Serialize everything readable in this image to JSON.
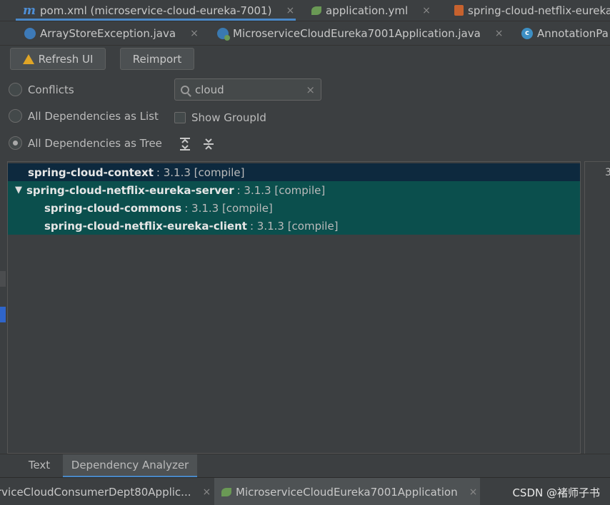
{
  "editor_tabs_row1": [
    {
      "label": "pom.xml (microservice-cloud-eureka-7001)",
      "icon": "maven-m-icon",
      "active": true
    },
    {
      "label": "application.yml",
      "icon": "spring-leaf-icon"
    },
    {
      "label": "spring-cloud-netflix-eureka",
      "icon": "xml-file-icon"
    }
  ],
  "editor_tabs_row2": [
    {
      "label": "ArrayStoreException.java",
      "icon": "exception-class-icon"
    },
    {
      "label": "MicroserviceCloudEureka7001Application.java",
      "icon": "spring-app-class-icon"
    },
    {
      "label": "AnnotationPa",
      "icon": "class-icon"
    }
  ],
  "toolbar": {
    "refresh_label": "Refresh UI",
    "reimport_label": "Reimport"
  },
  "view_options": {
    "conflicts": "Conflicts",
    "as_list": "All Dependencies as List",
    "as_tree": "All Dependencies as Tree",
    "selected": "as_tree",
    "show_group_id": "Show GroupId",
    "show_group_id_checked": false
  },
  "search": {
    "value": "cloud"
  },
  "tree": [
    {
      "name": "spring-cloud-context",
      "version": ": 3.1.3 [compile]",
      "level": 0,
      "state": "selected"
    },
    {
      "name": "spring-cloud-netflix-eureka-server",
      "version": ": 3.1.3 [compile]",
      "level": 0,
      "state": "match",
      "expanded": true
    },
    {
      "name": "spring-cloud-commons",
      "version": ": 3.1.3 [compile]",
      "level": 1,
      "state": "match"
    },
    {
      "name": "spring-cloud-netflix-eureka-client",
      "version": ": 3.1.3 [compile]",
      "level": 1,
      "state": "match"
    }
  ],
  "right_panel_text": "3",
  "bottom_tabs": [
    {
      "label": "Text"
    },
    {
      "label": "Dependency Analyzer",
      "active": true
    }
  ],
  "run_tabs": [
    {
      "label": "rviceCloudConsumerDept80Applic..."
    },
    {
      "label": "MicroserviceCloudEureka7001Application",
      "active": true
    }
  ],
  "watermark": "CSDN @褚师子书",
  "close_glyph": "×"
}
